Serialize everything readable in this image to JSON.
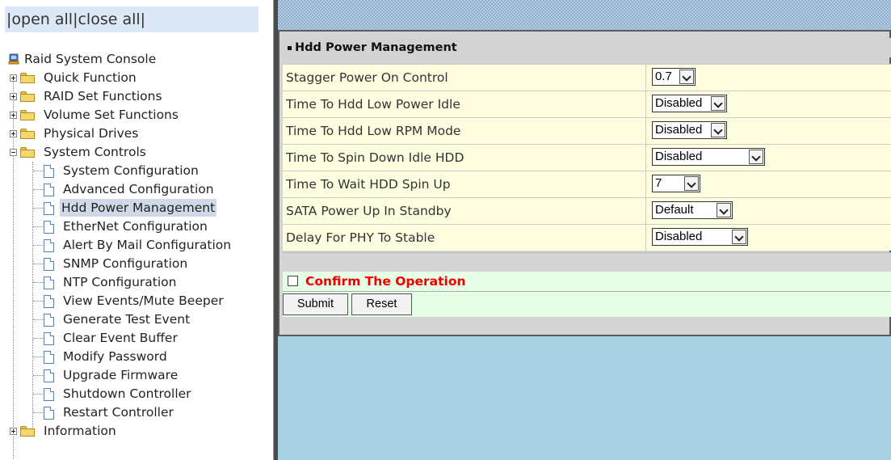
{
  "left_pane": {
    "open_close": {
      "sep1": "|",
      "open_all": "open all",
      "sep2": "|",
      "close_all": "close all",
      "sep3": "|"
    },
    "tree": {
      "root": "Raid System Console",
      "groups": [
        {
          "label": "Quick Function",
          "expanded": false
        },
        {
          "label": "RAID Set Functions",
          "expanded": false
        },
        {
          "label": "Volume Set Functions",
          "expanded": false
        },
        {
          "label": "Physical Drives",
          "expanded": false
        },
        {
          "label": "System Controls",
          "expanded": true
        },
        {
          "label": "Information",
          "expanded": false
        }
      ],
      "system_controls_items": [
        "System Configuration",
        "Advanced Configuration",
        "Hdd Power Management",
        "EtherNet Configuration",
        "Alert By Mail Configuration",
        "SNMP Configuration",
        "NTP Configuration",
        "View Events/Mute Beeper",
        "Generate Test Event",
        "Clear Event Buffer",
        "Modify Password",
        "Upgrade Firmware",
        "Shutdown Controller",
        "Restart Controller"
      ],
      "selected_item": "Hdd Power Management"
    }
  },
  "panel": {
    "title": "Hdd Power Management",
    "rows": [
      {
        "label": "Stagger Power On Control",
        "value": "0.7"
      },
      {
        "label": "Time To Hdd Low Power Idle",
        "value": "Disabled"
      },
      {
        "label": "Time To Hdd Low RPM Mode",
        "value": "Disabled"
      },
      {
        "label": "Time To Spin Down Idle HDD",
        "value": "Disabled"
      },
      {
        "label": "Time To Wait HDD Spin Up",
        "value": "7"
      },
      {
        "label": "SATA Power Up In Standby",
        "value": "Default"
      },
      {
        "label": "Delay For PHY To Stable",
        "value": "Disabled"
      }
    ],
    "confirm_label": "Confirm The Operation",
    "confirm_checked": false,
    "submit_label": "Submit",
    "reset_label": "Reset"
  },
  "colors": {
    "confirm_text": "#ee0000",
    "row_background": "#fffde0",
    "confirm_background": "#e6fde6",
    "right_background": "#a9d3e4"
  },
  "icons": {
    "root": "console-icon",
    "group": "folder-icon",
    "item": "page-icon",
    "expander": "plus-minus-icon"
  }
}
